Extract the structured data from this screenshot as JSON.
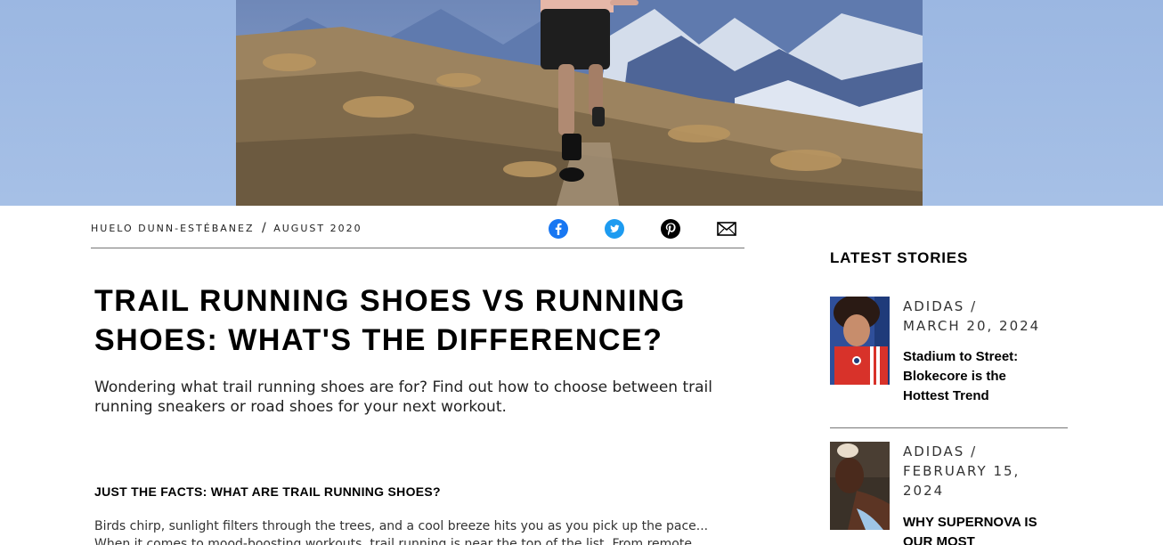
{
  "byline": {
    "author": "HUELO DUNN-ESTÉBANEZ",
    "separator": "/",
    "date": "AUGUST 2020"
  },
  "share": {
    "facebook_color": "#1877f2",
    "twitter_color": "#1d9bf0",
    "pinterest_color": "#000000",
    "icons": [
      "facebook-icon",
      "twitter-icon",
      "pinterest-icon",
      "email-icon"
    ]
  },
  "article": {
    "title": "TRAIL RUNNING SHOES VS RUNNING SHOES: WHAT'S THE DIFFERENCE?",
    "lede": "Wondering what trail running shoes are for? Find out how to choose between trail running sneakers or road shoes for your next workout.",
    "section_heading": "JUST THE FACTS: WHAT ARE TRAIL RUNNING SHOES?",
    "body": "Birds chirp, sunlight filters through the trees, and a cool breeze hits you as you pick up the pace... When it comes to mood-boosting workouts, trail running is near the top of the list. From remote"
  },
  "sidebar": {
    "title": "LATEST STORIES",
    "stories": [
      {
        "source": "ADIDAS /",
        "date": "MARCH 20, 2024",
        "title": "Stadium to Street: Blokecore is the Hottest Trend"
      },
      {
        "source": "ADIDAS /",
        "date": "FEBRUARY 15, 2024",
        "title": "WHY SUPERNOVA IS OUR MOST"
      }
    ]
  }
}
